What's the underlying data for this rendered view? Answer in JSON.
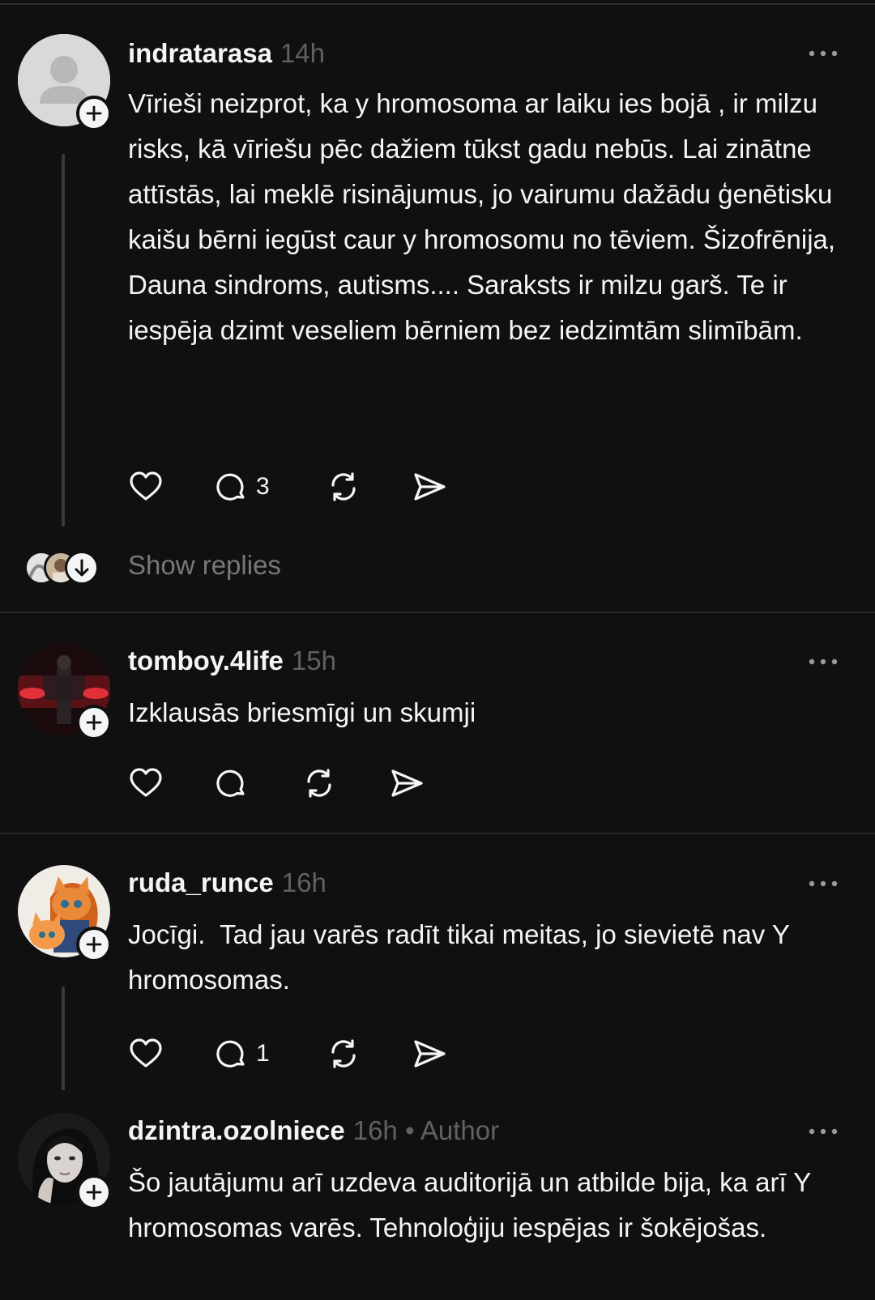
{
  "posts": [
    {
      "username": "indratarasa",
      "time": "14h",
      "text": "Vīrieši neizprot, ka y hromosoma ar laiku ies bojā , ir milzu risks, kā vīriešu pēc dažiem tūkst gadu nebūs. Lai zinātne attīstās, lai meklē risinājumus, jo vairumu dažādu ģenētisku kaišu bērni iegūst caur y hromosomu no tēviem. Šizofrēnija, Dauna sindroms, autisms.... Saraksts ir milzu garš. Te ir iespēja dzimt veseliem bērniem bez iedzimtām slimībām.",
      "reply_count": "3",
      "show_replies": "Show replies",
      "avatar": "default-avatar"
    },
    {
      "username": "tomboy.4life",
      "time": "15h",
      "text": "Izklausās briesmīgi un skumji",
      "reply_count": "",
      "avatar": "photo-avatar-red-stage"
    },
    {
      "username": "ruda_runce",
      "time": "16h",
      "text": "Jocīgi.  Tad jau varēs radīt tikai meitas, jo sievietē nav Y hromosomas.",
      "reply_count": "1",
      "avatar": "photo-avatar-orange-cats"
    },
    {
      "username": "dzintra.ozolniece",
      "time": "16h",
      "author_label": "• Author",
      "text": "Šo jautājumu arī uzdeva auditorijā un atbilde bija, ka arī Y hromosomas varēs. Tehnoloģiju iespējas ir šokējošas.",
      "avatar": "photo-avatar-woman"
    }
  ],
  "icons": [
    "like-icon",
    "comment-icon",
    "repost-icon",
    "share-icon",
    "more-icon",
    "follow-plus-icon",
    "arrow-down-icon"
  ],
  "colors": {
    "background": "#101010",
    "text": "#f3f5f7",
    "muted": "#616161",
    "divider": "#2a2a2a"
  }
}
